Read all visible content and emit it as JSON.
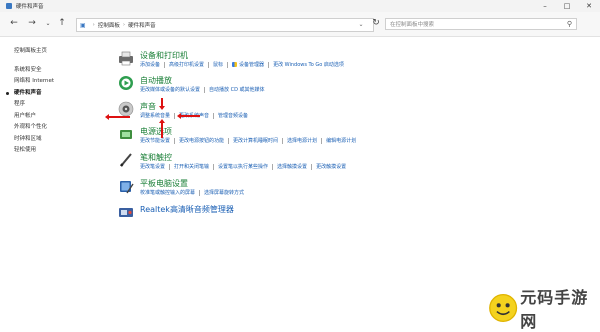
{
  "window": {
    "title": "硬件和声音"
  },
  "address": {
    "crumbs": [
      "控制面板",
      "硬件和声音"
    ],
    "search_placeholder": "在控制面板中搜索"
  },
  "sidebar": {
    "home": "控制面板主页",
    "items": [
      "系统和安全",
      "网络和 Internet",
      "硬件和声音",
      "程序",
      "用户帐户",
      "外观和个性化",
      "时钟和区域",
      "轻松使用"
    ],
    "active_index": 2
  },
  "categories": [
    {
      "title": "设备和打印机",
      "links": [
        "添加设备",
        "高级打印机设置",
        "鼠标",
        "设备管理器",
        "更改 Windows To Go 启动选项"
      ]
    },
    {
      "title": "自动播放",
      "links": [
        "更改媒体或设备的默认设置",
        "自动播放 CD 或其他媒体"
      ]
    },
    {
      "title": "声音",
      "links": [
        "调整系统音量",
        "更改系统声音",
        "管理音频设备"
      ]
    },
    {
      "title": "电源选项",
      "links": [
        "更改节能设置",
        "更改电源按钮的功能",
        "更改计算机睡眠时间",
        "选择电源计划",
        "编辑电源计划"
      ]
    },
    {
      "title": "笔和触控",
      "links": [
        "更改笔设置",
        "打开和关闭笔输",
        "设置笔以执行某些操作",
        "选择触摸设置",
        "更改触摸设置"
      ]
    },
    {
      "title": "平板电脑设置",
      "links": [
        "校准笔或触控输入的屏幕",
        "选择屏幕旋转方式"
      ]
    },
    {
      "title": "Realtek高清晰音频管理器",
      "links": []
    }
  ],
  "watermark": {
    "text": "元码手游网"
  }
}
